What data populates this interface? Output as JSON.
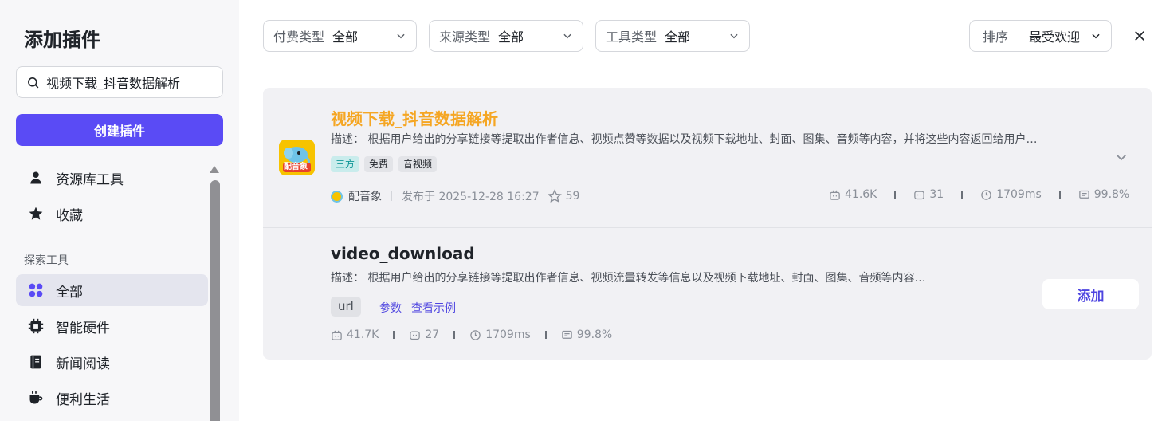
{
  "sidebar": {
    "title": "添加插件",
    "search_value": "视频下载_抖音数据解析",
    "create_label": "创建插件",
    "top_items": [
      {
        "label": "资源库工具",
        "icon": "user-icon"
      },
      {
        "label": "收藏",
        "icon": "star-icon"
      }
    ],
    "section_label": "探索工具",
    "explore_items": [
      {
        "label": "全部",
        "icon": "grid-icon",
        "active": true
      },
      {
        "label": "智能硬件",
        "icon": "chip-icon"
      },
      {
        "label": "新闻阅读",
        "icon": "book-icon"
      },
      {
        "label": "便利生活",
        "icon": "cup-icon"
      }
    ]
  },
  "filters": {
    "pay": {
      "label": "付费类型",
      "value": "全部"
    },
    "source": {
      "label": "来源类型",
      "value": "全部"
    },
    "tool": {
      "label": "工具类型",
      "value": "全部"
    },
    "sort": {
      "label": "排序",
      "value": "最受欢迎"
    }
  },
  "plugin": {
    "title": "视频下载_抖音数据解析",
    "title_color": "#f5a623",
    "description": "描述： 根据用户给出的分享链接等提取出作者信息、视频点赞等数据以及视频下载地址、封面、图集、音频等内容，并将这些内容返回给用户…",
    "icon_text": "配音象",
    "tags": [
      "三方",
      "免费",
      "音视频"
    ],
    "author": "配音象",
    "published": "发布于 2025-12-28 16:27",
    "stars": "59",
    "stats": {
      "calls": "41.6K",
      "bots": "31",
      "latency": "1709ms",
      "success": "99.8%"
    }
  },
  "tool": {
    "title": "video_download",
    "description": "描述： 根据用户给出的分享链接等提取出作者信息、视频流量转发等信息以及视频下载地址、封面、图集、音频等内容…",
    "param_tag": "url",
    "params_link": "参数",
    "example_link": "查看示例",
    "add_label": "添加",
    "stats": {
      "calls": "41.7K",
      "bots": "27",
      "latency": "1709ms",
      "success": "99.8%"
    }
  },
  "colors": {
    "accent": "#5a4bf5",
    "link": "#4e45e0",
    "card_bg": "#f1f1f4",
    "sidebar_bg": "#f7f7f9"
  }
}
